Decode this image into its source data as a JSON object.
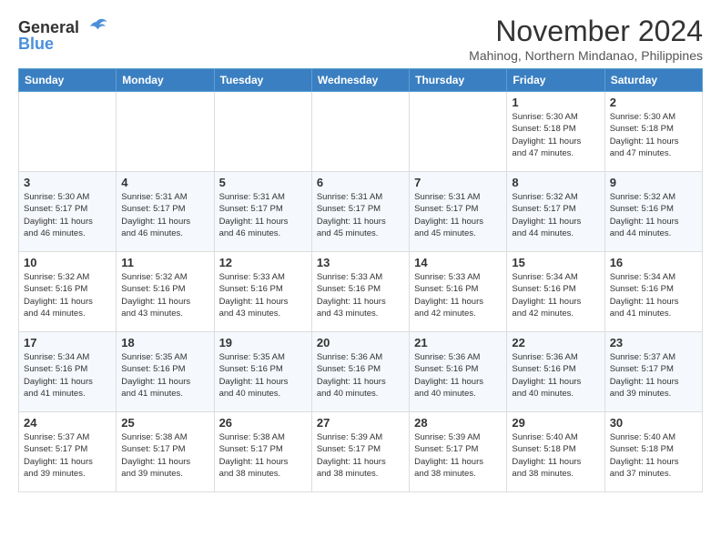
{
  "header": {
    "logo": {
      "line1": "General",
      "line2": "Blue"
    },
    "title": "November 2024",
    "location": "Mahinog, Northern Mindanao, Philippines"
  },
  "weekdays": [
    "Sunday",
    "Monday",
    "Tuesday",
    "Wednesday",
    "Thursday",
    "Friday",
    "Saturday"
  ],
  "weeks": [
    [
      {
        "day": "",
        "info": ""
      },
      {
        "day": "",
        "info": ""
      },
      {
        "day": "",
        "info": ""
      },
      {
        "day": "",
        "info": ""
      },
      {
        "day": "",
        "info": ""
      },
      {
        "day": "1",
        "info": "Sunrise: 5:30 AM\nSunset: 5:18 PM\nDaylight: 11 hours\nand 47 minutes."
      },
      {
        "day": "2",
        "info": "Sunrise: 5:30 AM\nSunset: 5:18 PM\nDaylight: 11 hours\nand 47 minutes."
      }
    ],
    [
      {
        "day": "3",
        "info": "Sunrise: 5:30 AM\nSunset: 5:17 PM\nDaylight: 11 hours\nand 46 minutes."
      },
      {
        "day": "4",
        "info": "Sunrise: 5:31 AM\nSunset: 5:17 PM\nDaylight: 11 hours\nand 46 minutes."
      },
      {
        "day": "5",
        "info": "Sunrise: 5:31 AM\nSunset: 5:17 PM\nDaylight: 11 hours\nand 46 minutes."
      },
      {
        "day": "6",
        "info": "Sunrise: 5:31 AM\nSunset: 5:17 PM\nDaylight: 11 hours\nand 45 minutes."
      },
      {
        "day": "7",
        "info": "Sunrise: 5:31 AM\nSunset: 5:17 PM\nDaylight: 11 hours\nand 45 minutes."
      },
      {
        "day": "8",
        "info": "Sunrise: 5:32 AM\nSunset: 5:17 PM\nDaylight: 11 hours\nand 44 minutes."
      },
      {
        "day": "9",
        "info": "Sunrise: 5:32 AM\nSunset: 5:16 PM\nDaylight: 11 hours\nand 44 minutes."
      }
    ],
    [
      {
        "day": "10",
        "info": "Sunrise: 5:32 AM\nSunset: 5:16 PM\nDaylight: 11 hours\nand 44 minutes."
      },
      {
        "day": "11",
        "info": "Sunrise: 5:32 AM\nSunset: 5:16 PM\nDaylight: 11 hours\nand 43 minutes."
      },
      {
        "day": "12",
        "info": "Sunrise: 5:33 AM\nSunset: 5:16 PM\nDaylight: 11 hours\nand 43 minutes."
      },
      {
        "day": "13",
        "info": "Sunrise: 5:33 AM\nSunset: 5:16 PM\nDaylight: 11 hours\nand 43 minutes."
      },
      {
        "day": "14",
        "info": "Sunrise: 5:33 AM\nSunset: 5:16 PM\nDaylight: 11 hours\nand 42 minutes."
      },
      {
        "day": "15",
        "info": "Sunrise: 5:34 AM\nSunset: 5:16 PM\nDaylight: 11 hours\nand 42 minutes."
      },
      {
        "day": "16",
        "info": "Sunrise: 5:34 AM\nSunset: 5:16 PM\nDaylight: 11 hours\nand 41 minutes."
      }
    ],
    [
      {
        "day": "17",
        "info": "Sunrise: 5:34 AM\nSunset: 5:16 PM\nDaylight: 11 hours\nand 41 minutes."
      },
      {
        "day": "18",
        "info": "Sunrise: 5:35 AM\nSunset: 5:16 PM\nDaylight: 11 hours\nand 41 minutes."
      },
      {
        "day": "19",
        "info": "Sunrise: 5:35 AM\nSunset: 5:16 PM\nDaylight: 11 hours\nand 40 minutes."
      },
      {
        "day": "20",
        "info": "Sunrise: 5:36 AM\nSunset: 5:16 PM\nDaylight: 11 hours\nand 40 minutes."
      },
      {
        "day": "21",
        "info": "Sunrise: 5:36 AM\nSunset: 5:16 PM\nDaylight: 11 hours\nand 40 minutes."
      },
      {
        "day": "22",
        "info": "Sunrise: 5:36 AM\nSunset: 5:16 PM\nDaylight: 11 hours\nand 40 minutes."
      },
      {
        "day": "23",
        "info": "Sunrise: 5:37 AM\nSunset: 5:17 PM\nDaylight: 11 hours\nand 39 minutes."
      }
    ],
    [
      {
        "day": "24",
        "info": "Sunrise: 5:37 AM\nSunset: 5:17 PM\nDaylight: 11 hours\nand 39 minutes."
      },
      {
        "day": "25",
        "info": "Sunrise: 5:38 AM\nSunset: 5:17 PM\nDaylight: 11 hours\nand 39 minutes."
      },
      {
        "day": "26",
        "info": "Sunrise: 5:38 AM\nSunset: 5:17 PM\nDaylight: 11 hours\nand 38 minutes."
      },
      {
        "day": "27",
        "info": "Sunrise: 5:39 AM\nSunset: 5:17 PM\nDaylight: 11 hours\nand 38 minutes."
      },
      {
        "day": "28",
        "info": "Sunrise: 5:39 AM\nSunset: 5:17 PM\nDaylight: 11 hours\nand 38 minutes."
      },
      {
        "day": "29",
        "info": "Sunrise: 5:40 AM\nSunset: 5:18 PM\nDaylight: 11 hours\nand 38 minutes."
      },
      {
        "day": "30",
        "info": "Sunrise: 5:40 AM\nSunset: 5:18 PM\nDaylight: 11 hours\nand 37 minutes."
      }
    ]
  ]
}
